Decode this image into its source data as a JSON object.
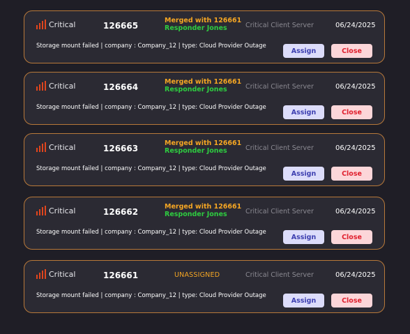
{
  "tickets": [
    {
      "severity": "Critical",
      "id": "126665",
      "merged": "Merged with 126661",
      "responder": "Responder Jones",
      "status": "",
      "server": "Critical Client Server",
      "date": "06/24/2025",
      "description": "Storage mount failed | company : Company_12 | type: Cloud Provider Outage",
      "assign_label": "Assign",
      "close_label": "Close"
    },
    {
      "severity": "Critical",
      "id": "126664",
      "merged": "Merged with 126661",
      "responder": "Responder Jones",
      "status": "",
      "server": "Critical Client Server",
      "date": "06/24/2025",
      "description": "Storage mount failed | company : Company_12 | type: Cloud Provider Outage",
      "assign_label": "Assign",
      "close_label": "Close"
    },
    {
      "severity": "Critical",
      "id": "126663",
      "merged": "Merged with 126661",
      "responder": "Responder Jones",
      "status": "",
      "server": "Critical Client Server",
      "date": "06/24/2025",
      "description": "Storage mount failed | company : Company_12 | type: Cloud Provider Outage",
      "assign_label": "Assign",
      "close_label": "Close"
    },
    {
      "severity": "Critical",
      "id": "126662",
      "merged": "Merged with 126661",
      "responder": "Responder Jones",
      "status": "",
      "server": "Critical Client Server",
      "date": "06/24/2025",
      "description": "Storage mount failed | company : Company_12 | type: Cloud Provider Outage",
      "assign_label": "Assign",
      "close_label": "Close"
    },
    {
      "severity": "Critical",
      "id": "126661",
      "merged": "",
      "responder": "",
      "status": "UNASSIGNED",
      "server": "Critical Client Server",
      "date": "06/24/2025",
      "description": "Storage mount failed | company : Company_12 | type: Cloud Provider Outage",
      "assign_label": "Assign",
      "close_label": "Close"
    }
  ],
  "colors": {
    "severity": "#e0451d",
    "merged": "#f5a623",
    "responder": "#2ecc40",
    "border": "#b8793a"
  },
  "icons": {
    "severity": "signal-bars-icon"
  }
}
